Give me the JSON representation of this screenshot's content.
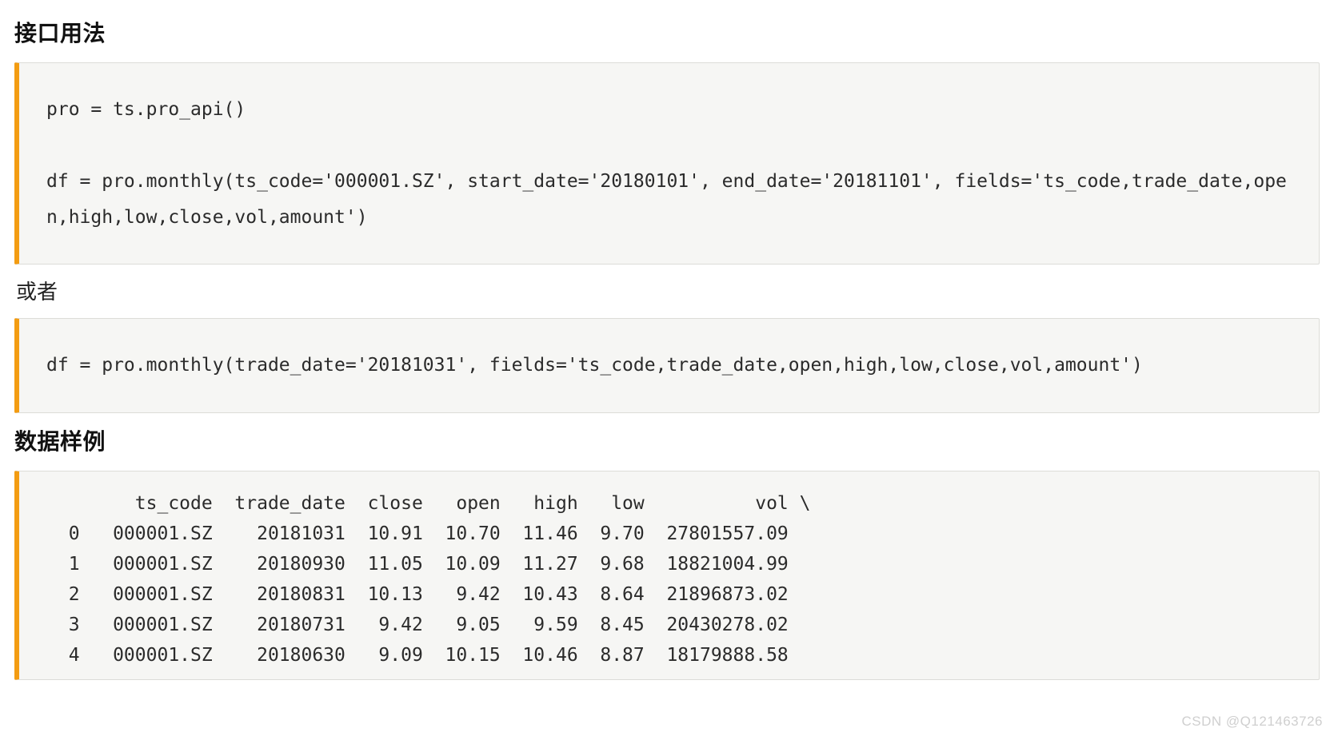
{
  "headings": {
    "usage": "接口用法",
    "sample": "数据样例"
  },
  "or_text": "或者",
  "code1": "pro = ts.pro_api()\n\ndf = pro.monthly(ts_code='000001.SZ', start_date='20180101', end_date='20181101', fields='ts_code,trade_date,open,high,low,close,vol,amount')",
  "code2": "df = pro.monthly(trade_date='20181031', fields='ts_code,trade_date,open,high,low,close,vol,amount')",
  "sample_table": {
    "columns": [
      "",
      "ts_code",
      "trade_date",
      "close",
      "open",
      "high",
      "low",
      "vol",
      "\\"
    ],
    "rows": [
      [
        "0",
        "000001.SZ",
        "20181031",
        "10.91",
        "10.70",
        "11.46",
        "9.70",
        "27801557.09",
        ""
      ],
      [
        "1",
        "000001.SZ",
        "20180930",
        "11.05",
        "10.09",
        "11.27",
        "9.68",
        "18821004.99",
        ""
      ],
      [
        "2",
        "000001.SZ",
        "20180831",
        "10.13",
        "9.42",
        "10.43",
        "8.64",
        "21896873.02",
        ""
      ],
      [
        "3",
        "000001.SZ",
        "20180731",
        "9.42",
        "9.05",
        "9.59",
        "8.45",
        "20430278.02",
        ""
      ],
      [
        "4",
        "000001.SZ",
        "20180630",
        "9.09",
        "10.15",
        "10.46",
        "8.87",
        "18179888.58",
        ""
      ]
    ]
  },
  "watermark": "CSDN @Q121463726"
}
